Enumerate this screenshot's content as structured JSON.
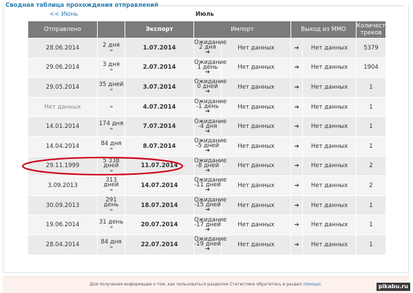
{
  "panel": {
    "title": "Сводная таблица прохождения отправлений",
    "prev_month": "<< Июнь",
    "current_month": "Июль"
  },
  "table": {
    "headers": {
      "sent": "Отправлено",
      "export": "Экспорт",
      "import": "Импорт",
      "mmo_exit": "Выход из ММО",
      "tracks_count": "Количество треков"
    },
    "rows": [
      {
        "sent": "28.06.2014",
        "delay": "2 дня",
        "export": "1.07.2014",
        "wait": "Ожидание 2 дня",
        "import": "Нет данных",
        "mmo": "Нет данных",
        "count": "5379"
      },
      {
        "sent": "29.06.2014",
        "delay": "3 дня",
        "export": "2.07.2014",
        "wait": "Ожидание 1 день",
        "import": "Нет данных",
        "mmo": "Нет данных",
        "count": "1904"
      },
      {
        "sent": "29.05.2014",
        "delay": "35 дней",
        "export": "3.07.2014",
        "wait": "Ожидание 0 дней",
        "import": "Нет данных",
        "mmo": "Нет данных",
        "count": "1"
      },
      {
        "sent": "Нет данных",
        "delay": "",
        "export": "4.07.2014",
        "wait": "Ожидание -1 день",
        "import": "Нет данных",
        "mmo": "Нет данных",
        "count": "1"
      },
      {
        "sent": "14.01.2014",
        "delay": "174 дня",
        "export": "7.07.2014",
        "wait": "Ожидание -4 дня",
        "import": "Нет данных",
        "mmo": "Нет данных",
        "count": "1"
      },
      {
        "sent": "14.04.2014",
        "delay": "84 дня",
        "export": "8.07.2014",
        "wait": "Ожидание -5 дней",
        "import": "Нет данных",
        "mmo": "Нет данных",
        "count": "1"
      },
      {
        "sent": "29.11.1999",
        "delay": "5 338 дней",
        "export": "11.07.2014",
        "wait": "Ожидание -8 дней",
        "import": "Нет данных",
        "mmo": "Нет данных",
        "count": "2"
      },
      {
        "sent": "3.09.2013",
        "delay": "313 дней",
        "export": "14.07.2014",
        "wait": "Ожидание -11 дней",
        "import": "Нет данных",
        "mmo": "Нет данных",
        "count": "2"
      },
      {
        "sent": "30.09.2013",
        "delay": "291 день",
        "export": "18.07.2014",
        "wait": "Ожидание -15 дней",
        "import": "Нет данных",
        "mmo": "Нет данных",
        "count": "1"
      },
      {
        "sent": "19.06.2014",
        "delay": "31 день",
        "export": "20.07.2014",
        "wait": "Ожидание -17 дней",
        "import": "Нет данных",
        "mmo": "Нет данных",
        "count": "1"
      },
      {
        "sent": "28.04.2014",
        "delay": "84 дня",
        "export": "22.07.2014",
        "wait": "Ожидание -19 дней",
        "import": "Нет данных",
        "mmo": "Нет данных",
        "count": "1"
      }
    ]
  },
  "footer": {
    "text": "Для получения информации о том, как пользоваться разделом Статистики обратитесь в раздел",
    "link": "помощи",
    "end": "."
  },
  "watermark": "pikabu.ru",
  "colors": {
    "header_bg": "#7b7b7b",
    "title_blue": "#2a7fb0",
    "highlight_red": "#d0021b"
  },
  "icons": {
    "arrow": "arrow-right-icon"
  }
}
